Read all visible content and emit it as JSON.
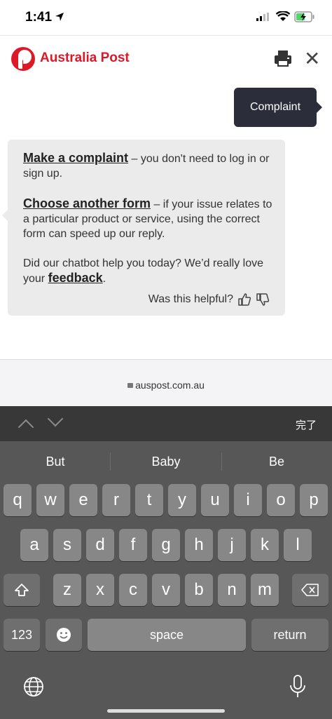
{
  "status": {
    "time": "1:41"
  },
  "header": {
    "brand": "Australia Post",
    "brand_color": "#dc1928"
  },
  "chat": {
    "user_message": "Complaint",
    "bot": {
      "link1": "Make a complaint",
      "text1": " – you don't need to log in or sign up.",
      "link2": "Choose another form",
      "text2": " – if your issue relates to a particular product or service, using the correct form can speed up our reply.",
      "text3": "Did our chatbot help you today? We’d really love your ",
      "link3": "feedback",
      "text3_end": ".",
      "helpful": "Was this helpful?"
    }
  },
  "browser": {
    "url": "auspost.com.au"
  },
  "keyboard": {
    "done": "完了",
    "suggestions": [
      "But",
      "Baby",
      "Be"
    ],
    "row1": [
      "q",
      "w",
      "e",
      "r",
      "t",
      "y",
      "u",
      "i",
      "o",
      "p"
    ],
    "row2": [
      "a",
      "s",
      "d",
      "f",
      "g",
      "h",
      "j",
      "k",
      "l"
    ],
    "row3": [
      "z",
      "x",
      "c",
      "v",
      "b",
      "n",
      "m"
    ],
    "numbers": "123",
    "space": "space",
    "return": "return"
  }
}
